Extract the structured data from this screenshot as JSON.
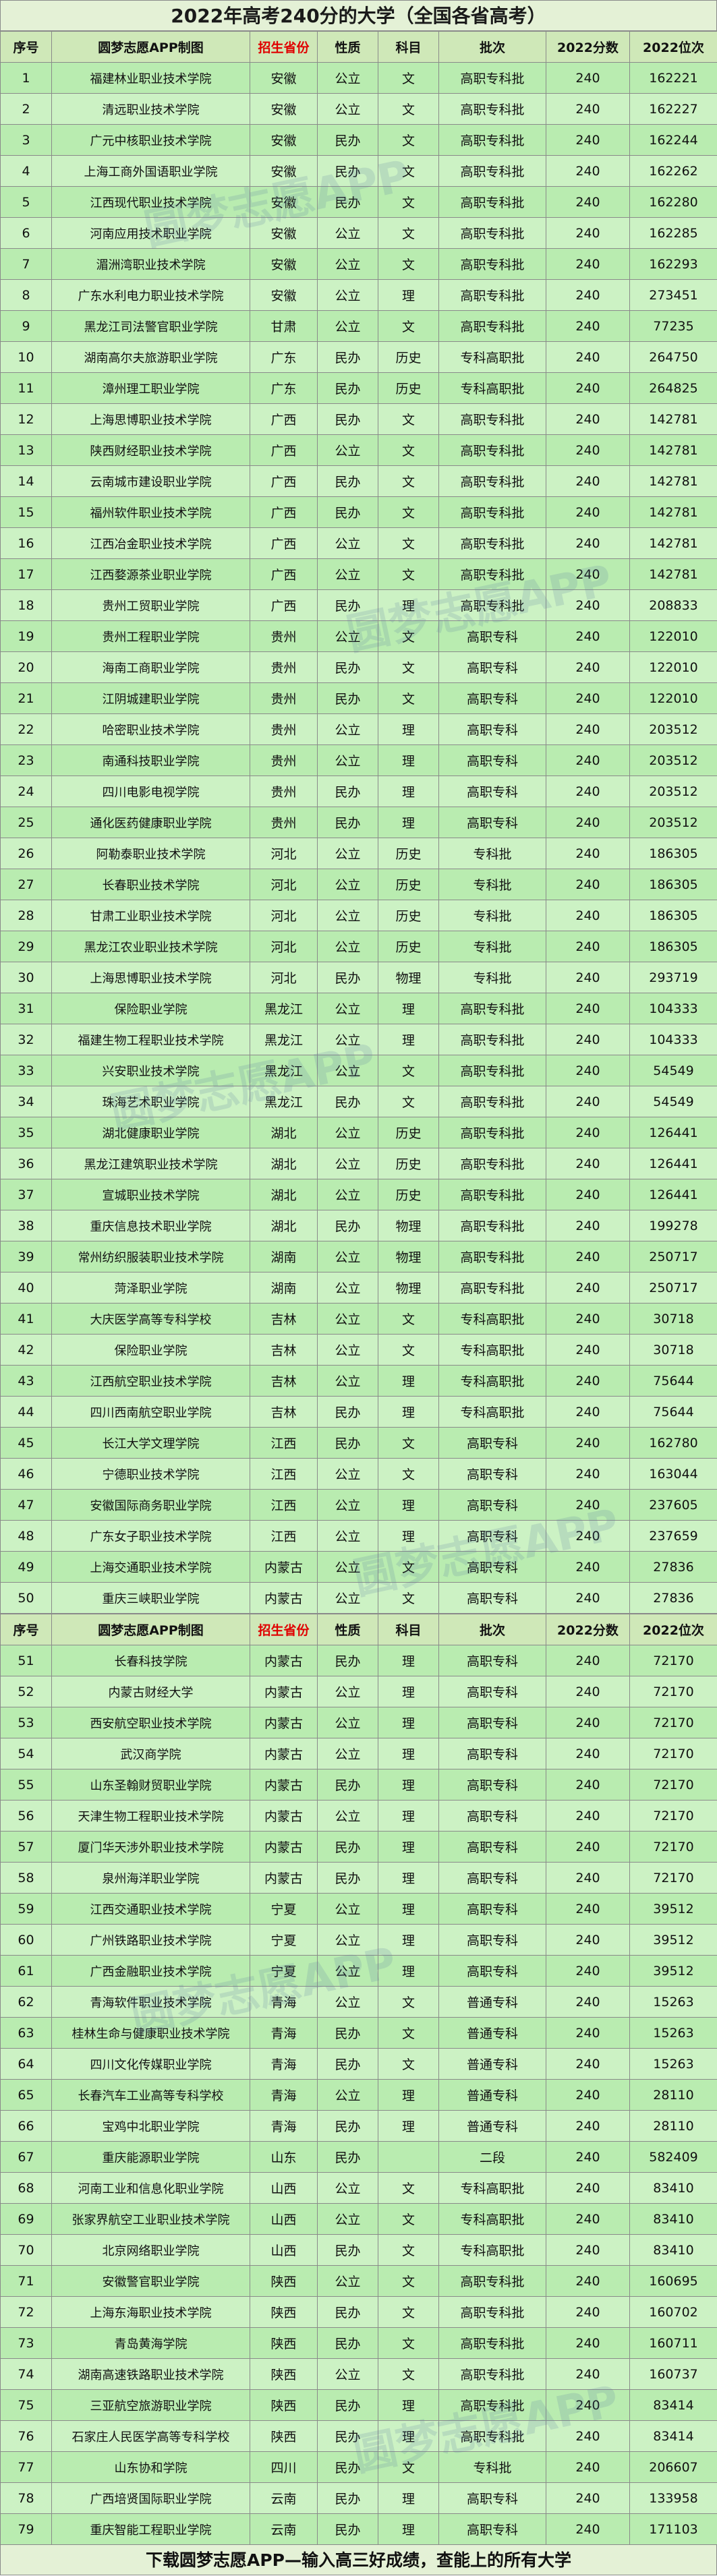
{
  "title": "2022年高考240分的大学（全国各省高考）",
  "headers": [
    "序号",
    "圆梦志愿APP制图",
    "招生省份",
    "性质",
    "科目",
    "批次",
    "2022分数",
    "2022位次"
  ],
  "watermark": "圆梦志愿APP",
  "footer": "下载圆梦志愿APP—输入高三好成绩，查能上的所有大学",
  "rows_part1": [
    [
      "1",
      "福建林业职业技术学院",
      "安徽",
      "公立",
      "文",
      "高职专科批",
      "240",
      "162221"
    ],
    [
      "2",
      "清远职业技术学院",
      "安徽",
      "公立",
      "文",
      "高职专科批",
      "240",
      "162227"
    ],
    [
      "3",
      "广元中核职业技术学院",
      "安徽",
      "民办",
      "文",
      "高职专科批",
      "240",
      "162244"
    ],
    [
      "4",
      "上海工商外国语职业学院",
      "安徽",
      "民办",
      "文",
      "高职专科批",
      "240",
      "162262"
    ],
    [
      "5",
      "江西现代职业技术学院",
      "安徽",
      "民办",
      "文",
      "高职专科批",
      "240",
      "162280"
    ],
    [
      "6",
      "河南应用技术职业学院",
      "安徽",
      "公立",
      "文",
      "高职专科批",
      "240",
      "162285"
    ],
    [
      "7",
      "湄洲湾职业技术学院",
      "安徽",
      "公立",
      "文",
      "高职专科批",
      "240",
      "162293"
    ],
    [
      "8",
      "广东水利电力职业技术学院",
      "安徽",
      "公立",
      "理",
      "高职专科批",
      "240",
      "273451"
    ],
    [
      "9",
      "黑龙江司法警官职业学院",
      "甘肃",
      "公立",
      "文",
      "高职专科批",
      "240",
      "77235"
    ],
    [
      "10",
      "湖南高尔夫旅游职业学院",
      "广东",
      "民办",
      "历史",
      "专科高职批",
      "240",
      "264750"
    ],
    [
      "11",
      "漳州理工职业学院",
      "广东",
      "民办",
      "历史",
      "专科高职批",
      "240",
      "264825"
    ],
    [
      "12",
      "上海思博职业技术学院",
      "广西",
      "民办",
      "文",
      "高职专科批",
      "240",
      "142781"
    ],
    [
      "13",
      "陕西财经职业技术学院",
      "广西",
      "公立",
      "文",
      "高职专科批",
      "240",
      "142781"
    ],
    [
      "14",
      "云南城市建设职业学院",
      "广西",
      "民办",
      "文",
      "高职专科批",
      "240",
      "142781"
    ],
    [
      "15",
      "福州软件职业技术学院",
      "广西",
      "民办",
      "文",
      "高职专科批",
      "240",
      "142781"
    ],
    [
      "16",
      "江西冶金职业技术学院",
      "广西",
      "公立",
      "文",
      "高职专科批",
      "240",
      "142781"
    ],
    [
      "17",
      "江西婺源茶业职业学院",
      "广西",
      "公立",
      "文",
      "高职专科批",
      "240",
      "142781"
    ],
    [
      "18",
      "贵州工贸职业学院",
      "广西",
      "民办",
      "理",
      "高职专科批",
      "240",
      "208833"
    ],
    [
      "19",
      "贵州工程职业学院",
      "贵州",
      "公立",
      "文",
      "高职专科",
      "240",
      "122010"
    ],
    [
      "20",
      "海南工商职业学院",
      "贵州",
      "民办",
      "文",
      "高职专科",
      "240",
      "122010"
    ],
    [
      "21",
      "江阴城建职业学院",
      "贵州",
      "民办",
      "文",
      "高职专科",
      "240",
      "122010"
    ],
    [
      "22",
      "哈密职业技术学院",
      "贵州",
      "公立",
      "理",
      "高职专科",
      "240",
      "203512"
    ],
    [
      "23",
      "南通科技职业学院",
      "贵州",
      "公立",
      "理",
      "高职专科",
      "240",
      "203512"
    ],
    [
      "24",
      "四川电影电视学院",
      "贵州",
      "民办",
      "理",
      "高职专科",
      "240",
      "203512"
    ],
    [
      "25",
      "通化医药健康职业学院",
      "贵州",
      "民办",
      "理",
      "高职专科",
      "240",
      "203512"
    ],
    [
      "26",
      "阿勒泰职业技术学院",
      "河北",
      "公立",
      "历史",
      "专科批",
      "240",
      "186305"
    ],
    [
      "27",
      "长春职业技术学院",
      "河北",
      "公立",
      "历史",
      "专科批",
      "240",
      "186305"
    ],
    [
      "28",
      "甘肃工业职业技术学院",
      "河北",
      "公立",
      "历史",
      "专科批",
      "240",
      "186305"
    ],
    [
      "29",
      "黑龙江农业职业技术学院",
      "河北",
      "公立",
      "历史",
      "专科批",
      "240",
      "186305"
    ],
    [
      "30",
      "上海思博职业技术学院",
      "河北",
      "民办",
      "物理",
      "专科批",
      "240",
      "293719"
    ],
    [
      "31",
      "保险职业学院",
      "黑龙江",
      "公立",
      "理",
      "高职专科批",
      "240",
      "104333"
    ],
    [
      "32",
      "福建生物工程职业技术学院",
      "黑龙江",
      "公立",
      "理",
      "高职专科批",
      "240",
      "104333"
    ],
    [
      "33",
      "兴安职业技术学院",
      "黑龙江",
      "公立",
      "文",
      "高职专科批",
      "240",
      "54549"
    ],
    [
      "34",
      "珠海艺术职业学院",
      "黑龙江",
      "民办",
      "文",
      "高职专科批",
      "240",
      "54549"
    ],
    [
      "35",
      "湖北健康职业学院",
      "湖北",
      "公立",
      "历史",
      "高职专科批",
      "240",
      "126441"
    ],
    [
      "36",
      "黑龙江建筑职业技术学院",
      "湖北",
      "公立",
      "历史",
      "高职专科批",
      "240",
      "126441"
    ],
    [
      "37",
      "宣城职业技术学院",
      "湖北",
      "公立",
      "历史",
      "高职专科批",
      "240",
      "126441"
    ],
    [
      "38",
      "重庆信息技术职业学院",
      "湖北",
      "民办",
      "物理",
      "高职专科批",
      "240",
      "199278"
    ],
    [
      "39",
      "常州纺织服装职业技术学院",
      "湖南",
      "公立",
      "物理",
      "高职专科批",
      "240",
      "250717"
    ],
    [
      "40",
      "菏泽职业学院",
      "湖南",
      "公立",
      "物理",
      "高职专科批",
      "240",
      "250717"
    ],
    [
      "41",
      "大庆医学高等专科学校",
      "吉林",
      "公立",
      "文",
      "专科高职批",
      "240",
      "30718"
    ],
    [
      "42",
      "保险职业学院",
      "吉林",
      "公立",
      "文",
      "专科高职批",
      "240",
      "30718"
    ],
    [
      "43",
      "江西航空职业技术学院",
      "吉林",
      "公立",
      "理",
      "专科高职批",
      "240",
      "75644"
    ],
    [
      "44",
      "四川西南航空职业学院",
      "吉林",
      "民办",
      "理",
      "专科高职批",
      "240",
      "75644"
    ],
    [
      "45",
      "长江大学文理学院",
      "江西",
      "民办",
      "文",
      "高职专科",
      "240",
      "162780"
    ],
    [
      "46",
      "宁德职业技术学院",
      "江西",
      "公立",
      "文",
      "高职专科",
      "240",
      "163044"
    ],
    [
      "47",
      "安徽国际商务职业学院",
      "江西",
      "公立",
      "理",
      "高职专科",
      "240",
      "237605"
    ],
    [
      "48",
      "广东女子职业技术学院",
      "江西",
      "公立",
      "理",
      "高职专科",
      "240",
      "237659"
    ],
    [
      "49",
      "上海交通职业技术学院",
      "内蒙古",
      "公立",
      "文",
      "高职专科",
      "240",
      "27836"
    ],
    [
      "50",
      "重庆三峡职业学院",
      "内蒙古",
      "公立",
      "文",
      "高职专科",
      "240",
      "27836"
    ]
  ],
  "rows_part2": [
    [
      "51",
      "长春科技学院",
      "内蒙古",
      "民办",
      "理",
      "高职专科",
      "240",
      "72170"
    ],
    [
      "52",
      "内蒙古财经大学",
      "内蒙古",
      "公立",
      "理",
      "高职专科",
      "240",
      "72170"
    ],
    [
      "53",
      "西安航空职业技术学院",
      "内蒙古",
      "公立",
      "理",
      "高职专科",
      "240",
      "72170"
    ],
    [
      "54",
      "武汉商学院",
      "内蒙古",
      "公立",
      "理",
      "高职专科",
      "240",
      "72170"
    ],
    [
      "55",
      "山东圣翰财贸职业学院",
      "内蒙古",
      "民办",
      "理",
      "高职专科",
      "240",
      "72170"
    ],
    [
      "56",
      "天津生物工程职业技术学院",
      "内蒙古",
      "公立",
      "理",
      "高职专科",
      "240",
      "72170"
    ],
    [
      "57",
      "厦门华天涉外职业技术学院",
      "内蒙古",
      "民办",
      "理",
      "高职专科",
      "240",
      "72170"
    ],
    [
      "58",
      "泉州海洋职业学院",
      "内蒙古",
      "民办",
      "理",
      "高职专科",
      "240",
      "72170"
    ],
    [
      "59",
      "江西交通职业技术学院",
      "宁夏",
      "公立",
      "理",
      "高职专科",
      "240",
      "39512"
    ],
    [
      "60",
      "广州铁路职业技术学院",
      "宁夏",
      "公立",
      "理",
      "高职专科",
      "240",
      "39512"
    ],
    [
      "61",
      "广西金融职业技术学院",
      "宁夏",
      "公立",
      "理",
      "高职专科",
      "240",
      "39512"
    ],
    [
      "62",
      "青海软件职业技术学院",
      "青海",
      "公立",
      "文",
      "普通专科",
      "240",
      "15263"
    ],
    [
      "63",
      "桂林生命与健康职业技术学院",
      "青海",
      "民办",
      "文",
      "普通专科",
      "240",
      "15263"
    ],
    [
      "64",
      "四川文化传媒职业学院",
      "青海",
      "民办",
      "文",
      "普通专科",
      "240",
      "15263"
    ],
    [
      "65",
      "长春汽车工业高等专科学校",
      "青海",
      "公立",
      "理",
      "普通专科",
      "240",
      "28110"
    ],
    [
      "66",
      "宝鸡中北职业学院",
      "青海",
      "民办",
      "理",
      "普通专科",
      "240",
      "28110"
    ],
    [
      "67",
      "重庆能源职业学院",
      "山东",
      "民办",
      "",
      "二段",
      "240",
      "582409"
    ],
    [
      "68",
      "河南工业和信息化职业学院",
      "山西",
      "公立",
      "文",
      "专科高职批",
      "240",
      "83410"
    ],
    [
      "69",
      "张家界航空工业职业技术学院",
      "山西",
      "公立",
      "文",
      "专科高职批",
      "240",
      "83410"
    ],
    [
      "70",
      "北京网络职业学院",
      "山西",
      "民办",
      "文",
      "专科高职批",
      "240",
      "83410"
    ],
    [
      "71",
      "安徽警官职业学院",
      "陕西",
      "公立",
      "文",
      "高职专科批",
      "240",
      "160695"
    ],
    [
      "72",
      "上海东海职业技术学院",
      "陕西",
      "民办",
      "文",
      "高职专科批",
      "240",
      "160702"
    ],
    [
      "73",
      "青岛黄海学院",
      "陕西",
      "民办",
      "文",
      "高职专科批",
      "240",
      "160711"
    ],
    [
      "74",
      "湖南高速铁路职业技术学院",
      "陕西",
      "公立",
      "文",
      "高职专科批",
      "240",
      "160737"
    ],
    [
      "75",
      "三亚航空旅游职业学院",
      "陕西",
      "民办",
      "理",
      "高职专科批",
      "240",
      "83414"
    ],
    [
      "76",
      "石家庄人民医学高等专科学校",
      "陕西",
      "民办",
      "理",
      "高职专科批",
      "240",
      "83414"
    ],
    [
      "77",
      "山东协和学院",
      "四川",
      "民办",
      "文",
      "专科批",
      "240",
      "206607"
    ],
    [
      "78",
      "广西培贤国际职业学院",
      "云南",
      "民办",
      "理",
      "高职专科",
      "240",
      "133958"
    ],
    [
      "79",
      "重庆智能工程职业学院",
      "云南",
      "民办",
      "理",
      "高职专科",
      "240",
      "171103"
    ]
  ]
}
